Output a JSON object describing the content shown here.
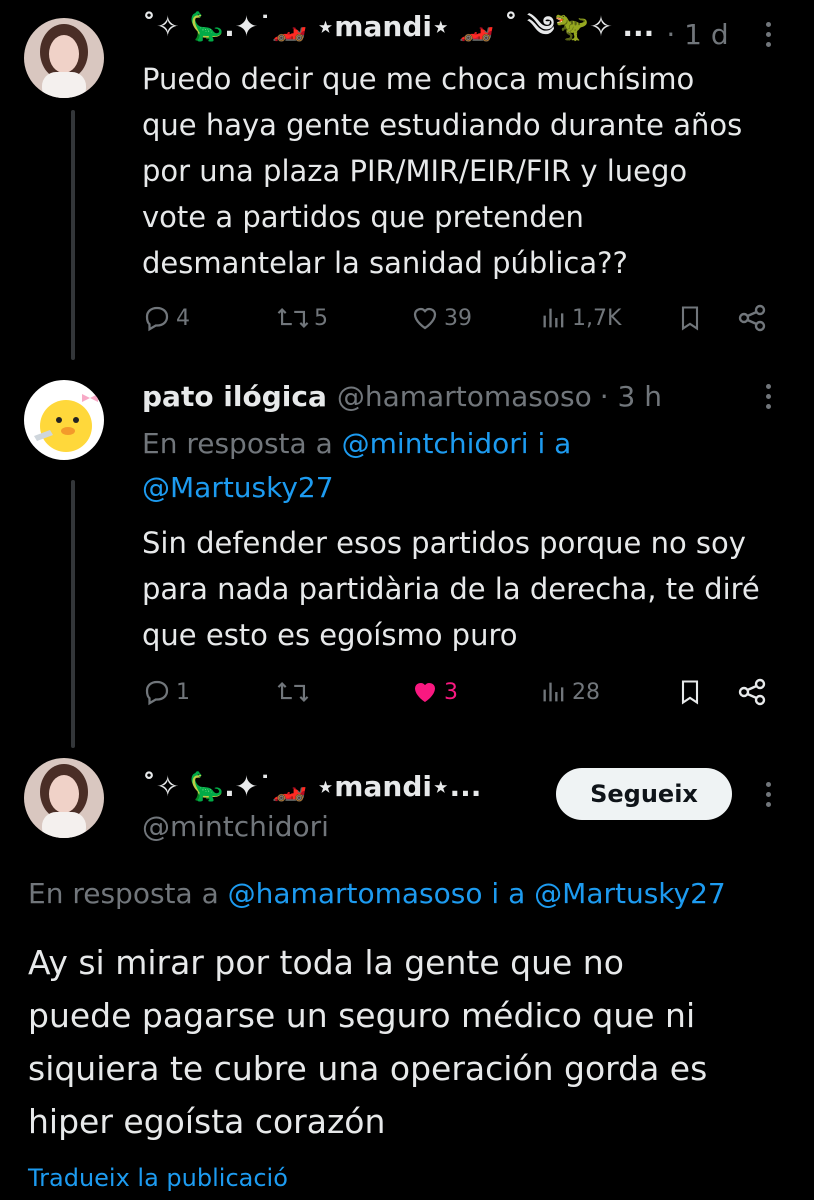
{
  "tweet1": {
    "display_name": "˚✧ 🦕.✦˙🏎️ ⋆mandi⋆ 🏎️ ˚ ༄🦖✧ ...",
    "time": "· 1 d",
    "text_lines": [
      "Puedo decir que me choca muchísimo",
      "que haya gente estudiando durante años",
      "por una plaza PIR/MIR/EIR/FIR y luego",
      "vote a partidos que pretenden",
      "desmantelar la sanidad pública??"
    ],
    "replies": "4",
    "reposts": "5",
    "likes": "39",
    "views": "1,7K"
  },
  "tweet2": {
    "display_name": "pato ilógica",
    "handle": "@hamartomasoso",
    "time": "· 3 h",
    "reply_prefix": "En resposta a",
    "reply_user1": "@mintchidori",
    "reply_joiner": "i a",
    "reply_user2": "@Martusky27",
    "text_lines": [
      "Sin defender esos partidos porque no soy",
      "para nada partidària de la derecha, te diré",
      "que esto es egoísmo puro"
    ],
    "replies": "1",
    "reposts": "",
    "likes": "3",
    "views": "28",
    "like_color": "#f91880"
  },
  "tweet3": {
    "display_name": "˚✧ 🦕.✦˙🏎️ ⋆mandi⋆...",
    "handle": "@mintchidori",
    "follow_label": "Segueix",
    "reply_prefix": "En resposta a",
    "reply_user1": "@hamartomasoso",
    "reply_joiner": "i a",
    "reply_user2": "@Martusky27",
    "text_lines": [
      "Ay si mirar por toda la gente que no",
      "puede pagarse un seguro médico que ni",
      "siquiera te cubre una operación gorda es",
      "hiper egoísta corazón"
    ],
    "translate_label": "Tradueix la publicació"
  },
  "colors": {
    "accent": "#1d9bf0",
    "dim": "#71767b",
    "like": "#f91880",
    "background": "#000000"
  }
}
